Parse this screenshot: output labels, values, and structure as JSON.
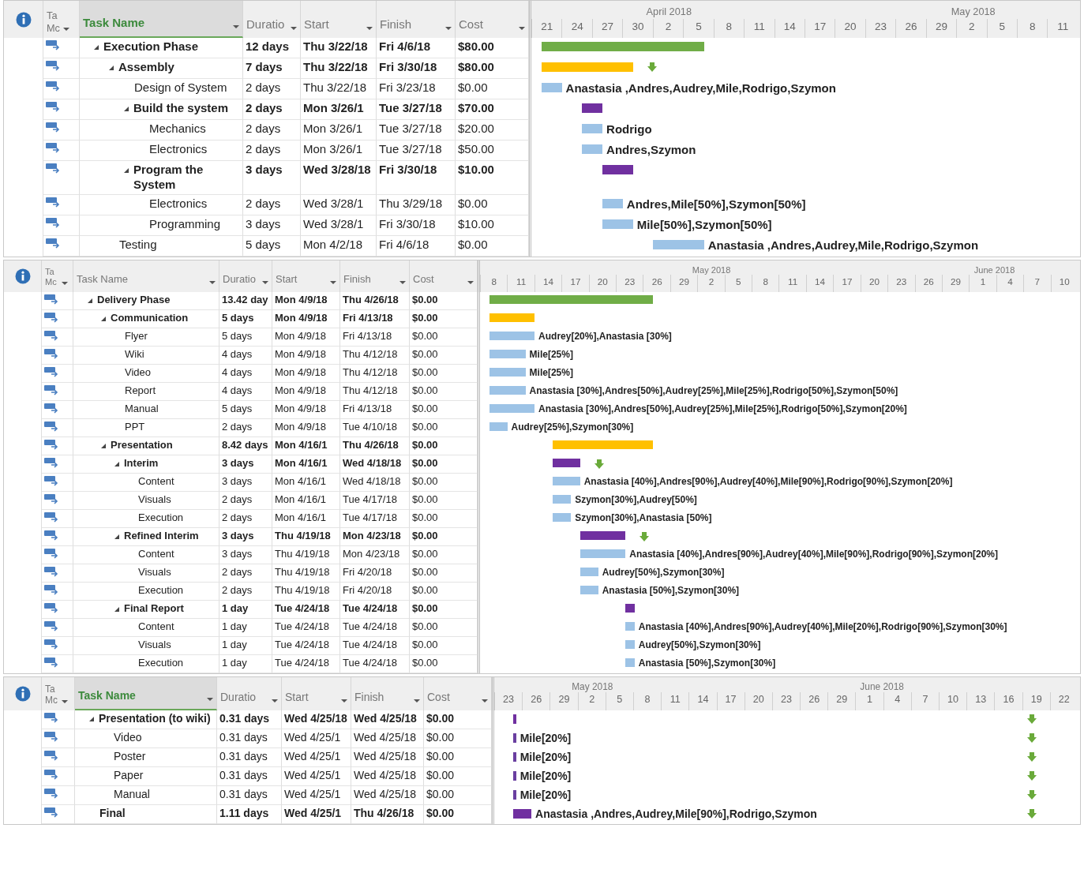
{
  "panels": [
    {
      "mode_header": "Ta Mc",
      "columns": [
        {
          "label": "Task Name",
          "selected": true
        },
        {
          "label": "Duratio",
          "selected": false
        },
        {
          "label": "Start",
          "selected": false
        },
        {
          "label": "Finish",
          "selected": false
        },
        {
          "label": "Cost",
          "selected": false
        }
      ],
      "months": [
        "April 2018",
        "May 2018"
      ],
      "days": [
        "21",
        "24",
        "27",
        "30",
        "2",
        "5",
        "8",
        "11",
        "14",
        "17",
        "20",
        "23",
        "26",
        "29",
        "2",
        "5",
        "8",
        "11"
      ],
      "rows": [
        {
          "name": "Execution Phase",
          "summary": true,
          "expanded": true,
          "duration": "12 days",
          "start": "Thu 3/22/18",
          "finish": "Fri 4/6/18",
          "cost": "$80.00",
          "color": "#70ad47",
          "children": [
            {
              "name": "Assembly",
              "summary": true,
              "expanded": true,
              "duration": "7 days",
              "start": "Thu 3/22/18",
              "finish": "Fri 3/30/18",
              "cost": "$80.00",
              "color": "#ffc000",
              "deadline": true,
              "children": [
                {
                  "name": "Design of System",
                  "summary": false,
                  "duration": "2 days",
                  "start": "Thu 3/22/18",
                  "finish": "Fri 3/23/18",
                  "cost": "$0.00",
                  "color": "#9dc3e6",
                  "resources": "Anastasia ,Andres,Audrey,Mile,Rodrigo,Szymon"
                },
                {
                  "name": "Build the system",
                  "summary": true,
                  "expanded": true,
                  "duration": "2 days",
                  "start": "Mon 3/26/1",
                  "finish": "Tue 3/27/18",
                  "cost": "$70.00",
                  "color": "#7030a0",
                  "children": [
                    {
                      "name": "Mechanics",
                      "summary": false,
                      "duration": "2 days",
                      "start": "Mon 3/26/1",
                      "finish": "Tue 3/27/18",
                      "cost": "$20.00",
                      "color": "#9dc3e6",
                      "resources": "Rodrigo"
                    },
                    {
                      "name": "Electronics",
                      "summary": false,
                      "duration": "2 days",
                      "start": "Mon 3/26/1",
                      "finish": "Tue 3/27/18",
                      "cost": "$50.00",
                      "color": "#9dc3e6",
                      "resources": "Andres,Szymon"
                    }
                  ]
                },
                {
                  "name": "Program the System",
                  "summary": true,
                  "expanded": true,
                  "duration": "3 days",
                  "start": "Wed 3/28/18",
                  "finish": "Fri 3/30/18",
                  "cost": "$10.00",
                  "color": "#7030a0",
                  "children": [
                    {
                      "name": "Electronics",
                      "summary": false,
                      "duration": "2 days",
                      "start": "Wed 3/28/1",
                      "finish": "Thu 3/29/18",
                      "cost": "$0.00",
                      "color": "#9dc3e6",
                      "resources": "Andres,Mile[50%],Szymon[50%]"
                    },
                    {
                      "name": "Programming",
                      "summary": false,
                      "duration": "3 days",
                      "start": "Wed 3/28/1",
                      "finish": "Fri 3/30/18",
                      "cost": "$10.00",
                      "color": "#9dc3e6",
                      "resources": "Mile[50%],Szymon[50%]"
                    }
                  ]
                }
              ]
            },
            {
              "name": "Testing",
              "summary": false,
              "duration": "5 days",
              "start": "Mon 4/2/18",
              "finish": "Fri 4/6/18",
              "cost": "$0.00",
              "color": "#9dc3e6",
              "resources": "Anastasia ,Andres,Audrey,Mile,Rodrigo,Szymon"
            }
          ]
        }
      ]
    },
    {
      "mode_header": "Ta Mc",
      "columns": [
        {
          "label": "Task Name",
          "selected": false
        },
        {
          "label": "Duratio",
          "selected": false
        },
        {
          "label": "Start",
          "selected": false
        },
        {
          "label": "Finish",
          "selected": false
        },
        {
          "label": "Cost",
          "selected": false
        }
      ],
      "months": [
        "May 2018",
        "June 2018"
      ],
      "days": [
        "8",
        "11",
        "14",
        "17",
        "20",
        "23",
        "26",
        "29",
        "2",
        "5",
        "8",
        "11",
        "14",
        "17",
        "20",
        "23",
        "26",
        "29",
        "1",
        "4",
        "7",
        "10"
      ],
      "rows": [
        {
          "name": "Delivery Phase",
          "summary": true,
          "expanded": true,
          "duration": "13.42 day",
          "start": "Mon 4/9/18",
          "finish": "Thu 4/26/18",
          "cost": "$0.00",
          "color": "#70ad47",
          "children": [
            {
              "name": "Communication",
              "summary": true,
              "expanded": true,
              "duration": "5 days",
              "start": "Mon 4/9/18",
              "finish": "Fri 4/13/18",
              "cost": "$0.00",
              "color": "#ffc000",
              "children": [
                {
                  "name": "Flyer",
                  "summary": false,
                  "duration": "5 days",
                  "start": "Mon 4/9/18",
                  "finish": "Fri 4/13/18",
                  "cost": "$0.00",
                  "color": "#9dc3e6",
                  "resources": "Audrey[20%],Anastasia [30%]"
                },
                {
                  "name": "Wiki",
                  "summary": false,
                  "duration": "4 days",
                  "start": "Mon 4/9/18",
                  "finish": "Thu 4/12/18",
                  "cost": "$0.00",
                  "color": "#9dc3e6",
                  "resources": "Mile[25%]"
                },
                {
                  "name": "Video",
                  "summary": false,
                  "duration": "4 days",
                  "start": "Mon 4/9/18",
                  "finish": "Thu 4/12/18",
                  "cost": "$0.00",
                  "color": "#9dc3e6",
                  "resources": "Mile[25%]"
                },
                {
                  "name": "Report",
                  "summary": false,
                  "duration": "4 days",
                  "start": "Mon 4/9/18",
                  "finish": "Thu 4/12/18",
                  "cost": "$0.00",
                  "color": "#9dc3e6",
                  "resources": "Anastasia [30%],Andres[50%],Audrey[25%],Mile[25%],Rodrigo[50%],Szymon[50%]"
                },
                {
                  "name": "Manual",
                  "summary": false,
                  "duration": "5 days",
                  "start": "Mon 4/9/18",
                  "finish": "Fri 4/13/18",
                  "cost": "$0.00",
                  "color": "#9dc3e6",
                  "resources": "Anastasia [30%],Andres[50%],Audrey[25%],Mile[25%],Rodrigo[50%],Szymon[20%]"
                },
                {
                  "name": "PPT",
                  "summary": false,
                  "duration": "2 days",
                  "start": "Mon 4/9/18",
                  "finish": "Tue 4/10/18",
                  "cost": "$0.00",
                  "color": "#9dc3e6",
                  "resources": "Audrey[25%],Szymon[30%]"
                }
              ]
            },
            {
              "name": "Presentation",
              "summary": true,
              "expanded": true,
              "duration": "8.42 days",
              "start": "Mon 4/16/1",
              "finish": "Thu 4/26/18",
              "cost": "$0.00",
              "color": "#ffc000",
              "children": [
                {
                  "name": "Interim",
                  "summary": true,
                  "expanded": true,
                  "duration": "3 days",
                  "start": "Mon 4/16/1",
                  "finish": "Wed 4/18/18",
                  "cost": "$0.00",
                  "color": "#7030a0",
                  "deadline": true,
                  "children": [
                    {
                      "name": "Content",
                      "summary": false,
                      "duration": "3 days",
                      "start": "Mon 4/16/1",
                      "finish": "Wed 4/18/18",
                      "cost": "$0.00",
                      "color": "#9dc3e6",
                      "resources": "Anastasia [40%],Andres[90%],Audrey[40%],Mile[90%],Rodrigo[90%],Szymon[20%]"
                    },
                    {
                      "name": "Visuals",
                      "summary": false,
                      "duration": "2 days",
                      "start": "Mon 4/16/1",
                      "finish": "Tue 4/17/18",
                      "cost": "$0.00",
                      "color": "#9dc3e6",
                      "resources": "Szymon[30%],Audrey[50%]"
                    },
                    {
                      "name": "Execution",
                      "summary": false,
                      "duration": "2 days",
                      "start": "Mon 4/16/1",
                      "finish": "Tue 4/17/18",
                      "cost": "$0.00",
                      "color": "#9dc3e6",
                      "resources": "Szymon[30%],Anastasia [50%]"
                    }
                  ]
                },
                {
                  "name": "Refined Interim",
                  "summary": true,
                  "expanded": true,
                  "duration": "3 days",
                  "start": "Thu 4/19/18",
                  "finish": "Mon 4/23/18",
                  "cost": "$0.00",
                  "color": "#7030a0",
                  "deadline": true,
                  "children": [
                    {
                      "name": "Content",
                      "summary": false,
                      "duration": "3 days",
                      "start": "Thu 4/19/18",
                      "finish": "Mon 4/23/18",
                      "cost": "$0.00",
                      "color": "#9dc3e6",
                      "resources": "Anastasia [40%],Andres[90%],Audrey[40%],Mile[90%],Rodrigo[90%],Szymon[20%]"
                    },
                    {
                      "name": "Visuals",
                      "summary": false,
                      "duration": "2 days",
                      "start": "Thu 4/19/18",
                      "finish": "Fri 4/20/18",
                      "cost": "$0.00",
                      "color": "#9dc3e6",
                      "resources": "Audrey[50%],Szymon[30%]"
                    },
                    {
                      "name": "Execution",
                      "summary": false,
                      "duration": "2 days",
                      "start": "Thu 4/19/18",
                      "finish": "Fri 4/20/18",
                      "cost": "$0.00",
                      "color": "#9dc3e6",
                      "resources": "Anastasia [50%],Szymon[30%]"
                    }
                  ]
                },
                {
                  "name": "Final Report",
                  "summary": true,
                  "expanded": true,
                  "duration": "1 day",
                  "start": "Tue 4/24/18",
                  "finish": "Tue 4/24/18",
                  "cost": "$0.00",
                  "color": "#7030a0",
                  "children": [
                    {
                      "name": "Content",
                      "summary": false,
                      "duration": "1 day",
                      "start": "Tue 4/24/18",
                      "finish": "Tue 4/24/18",
                      "cost": "$0.00",
                      "color": "#9dc3e6",
                      "resources": "Anastasia [40%],Andres[90%],Audrey[40%],Mile[20%],Rodrigo[90%],Szymon[30%]"
                    },
                    {
                      "name": "Visuals",
                      "summary": false,
                      "duration": "1 day",
                      "start": "Tue 4/24/18",
                      "finish": "Tue 4/24/18",
                      "cost": "$0.00",
                      "color": "#9dc3e6",
                      "resources": "Audrey[50%],Szymon[30%]"
                    },
                    {
                      "name": "Execution",
                      "summary": false,
                      "duration": "1 day",
                      "start": "Tue 4/24/18",
                      "finish": "Tue 4/24/18",
                      "cost": "$0.00",
                      "color": "#9dc3e6",
                      "resources": "Anastasia [50%],Szymon[30%]"
                    }
                  ]
                }
              ]
            }
          ]
        }
      ]
    },
    {
      "mode_header": "Ta Mc",
      "columns": [
        {
          "label": "Task Name",
          "selected": true
        },
        {
          "label": "Duratio",
          "selected": false
        },
        {
          "label": "Start",
          "selected": false
        },
        {
          "label": "Finish",
          "selected": false
        },
        {
          "label": "Cost",
          "selected": false
        }
      ],
      "months": [
        "May 2018",
        "June 2018"
      ],
      "days": [
        "23",
        "26",
        "29",
        "2",
        "5",
        "8",
        "11",
        "14",
        "17",
        "20",
        "23",
        "26",
        "29",
        "1",
        "4",
        "7",
        "10",
        "13",
        "16",
        "19",
        "22"
      ],
      "rows": [
        {
          "name": "Presentation (to wiki)",
          "summary": true,
          "expanded": true,
          "duration": "0.31 days",
          "start": "Wed 4/25/18",
          "finish": "Wed 4/25/18",
          "cost": "$0.00",
          "color": "#7030a0",
          "deadline": true,
          "children": [
            {
              "name": "Video",
              "summary": false,
              "duration": "0.31 days",
              "start": "Wed 4/25/1",
              "finish": "Wed 4/25/18",
              "cost": "$0.00",
              "color": "#6a3fa0",
              "resources": "Mile[20%]",
              "deadline": true
            },
            {
              "name": "Poster",
              "summary": false,
              "duration": "0.31 days",
              "start": "Wed 4/25/1",
              "finish": "Wed 4/25/18",
              "cost": "$0.00",
              "color": "#6a3fa0",
              "resources": "Mile[20%]",
              "deadline": true
            },
            {
              "name": "Paper",
              "summary": false,
              "duration": "0.31 days",
              "start": "Wed 4/25/1",
              "finish": "Wed 4/25/18",
              "cost": "$0.00",
              "color": "#6a3fa0",
              "resources": "Mile[20%]",
              "deadline": true
            },
            {
              "name": "Manual",
              "summary": false,
              "duration": "0.31 days",
              "start": "Wed 4/25/1",
              "finish": "Wed 4/25/18",
              "cost": "$0.00",
              "color": "#6a3fa0",
              "resources": "Mile[20%]",
              "deadline": true
            }
          ]
        },
        {
          "name": "Final",
          "summary": true,
          "duration": "1.11 days",
          "start": "Wed 4/25/1",
          "finish": "Thu 4/26/18",
          "cost": "$0.00",
          "color": "#7030a0",
          "resources": "Anastasia ,Andres,Audrey,Mile[90%],Rodrigo,Szymon",
          "deadline": true
        }
      ]
    }
  ]
}
